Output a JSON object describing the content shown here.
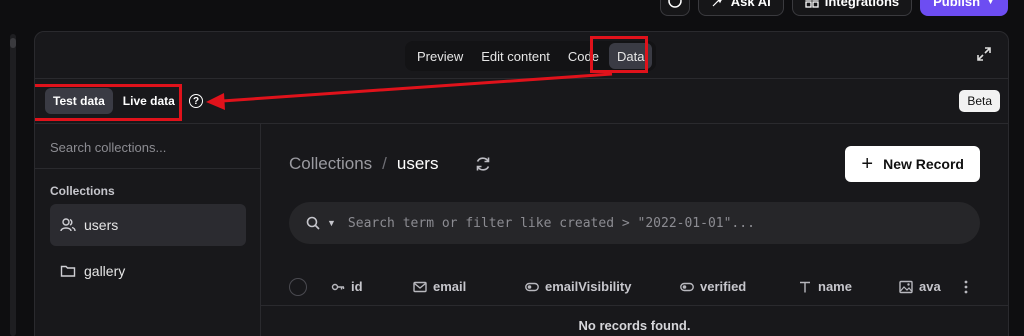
{
  "toolbar": {
    "ask_ai": "Ask AI",
    "integrations": "Integrations",
    "publish": "Publish"
  },
  "view_tabs": [
    {
      "label": "Preview",
      "active": false
    },
    {
      "label": "Edit content",
      "active": false
    },
    {
      "label": "Code",
      "active": false
    },
    {
      "label": "Data",
      "active": true
    }
  ],
  "data_mode": {
    "test": "Test data",
    "live": "Live data",
    "active": "test"
  },
  "beta_badge": "Beta",
  "sidebar": {
    "search_placeholder": "Search collections...",
    "heading": "Collections",
    "items": [
      {
        "label": "users",
        "icon": "users-icon",
        "active": true
      },
      {
        "label": "gallery",
        "icon": "folder-icon",
        "active": false
      }
    ]
  },
  "main": {
    "breadcrumb_root": "Collections",
    "breadcrumb_sep": "/",
    "breadcrumb_current": "users",
    "new_record": "New Record",
    "search_placeholder": "Search term or filter like created > \"2022-01-01\"...",
    "columns": [
      {
        "label": "id",
        "icon": "key-icon"
      },
      {
        "label": "email",
        "icon": "mail-icon"
      },
      {
        "label": "emailVisibility",
        "icon": "toggle-icon"
      },
      {
        "label": "verified",
        "icon": "toggle-icon"
      },
      {
        "label": "name",
        "icon": "text-icon"
      },
      {
        "label": "ava",
        "icon": "image-icon"
      }
    ],
    "empty_message": "No records found."
  },
  "colors": {
    "highlight": "#e0121b",
    "publish": "#6d4df2",
    "background": "#18181b"
  }
}
